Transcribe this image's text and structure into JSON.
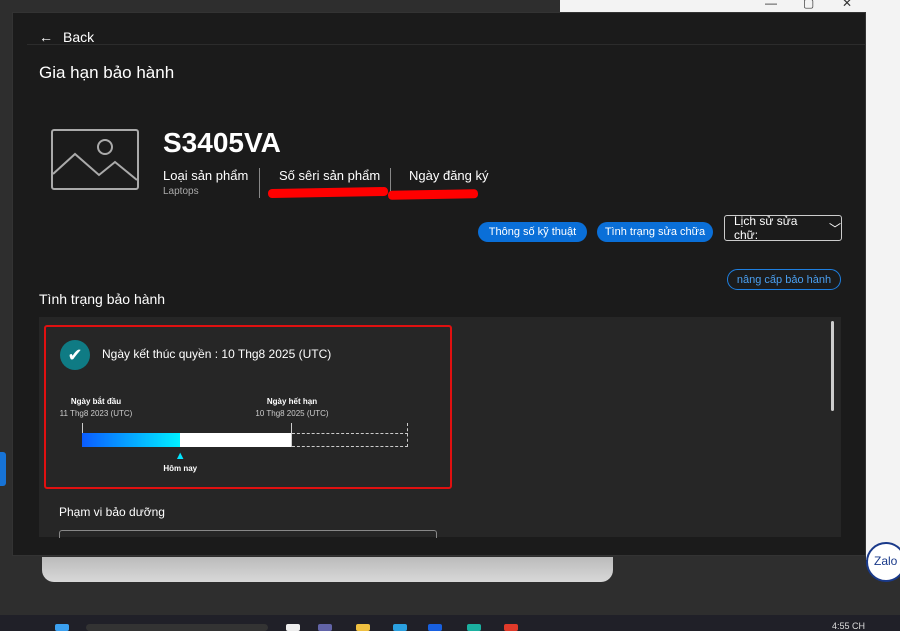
{
  "window": {
    "back_label": "Back",
    "title": "Gia hạn bảo hành"
  },
  "product": {
    "model": "S3405VA",
    "type_label": "Loại sản phẩm",
    "type_value": "Laptops",
    "serial_label": "Số sêri sản phẩm",
    "reg_label": "Ngày đăng ký"
  },
  "actions": {
    "specs": "Thông số kỹ thuật",
    "repair_status": "Tình trạng sửa chữa",
    "repair_history": "Lịch sử sửa chữ:",
    "upgrade": "nâng cấp bảo hành"
  },
  "warranty": {
    "section_title": "Tình trạng bảo hành",
    "end_label": "Ngày kết thúc quyền : 10 Thg8 2025 (UTC)",
    "start_label": "Ngày bắt đầu",
    "start_date": "11 Thg8 2023 (UTC)",
    "expiry_label": "Ngày hết hạn",
    "expiry_date": "10 Thg8 2025 (UTC)",
    "today_label": "Hôm nay",
    "elapsed_fraction": 0.47,
    "scope_title": "Phạm vi bảo dưỡng"
  },
  "taskbar": {
    "time": "4:55 CH"
  },
  "zalo": "Zalo",
  "colors": {
    "accent": "#0a6fd8",
    "highlight": "#e01010",
    "check": "#0f7b84"
  }
}
